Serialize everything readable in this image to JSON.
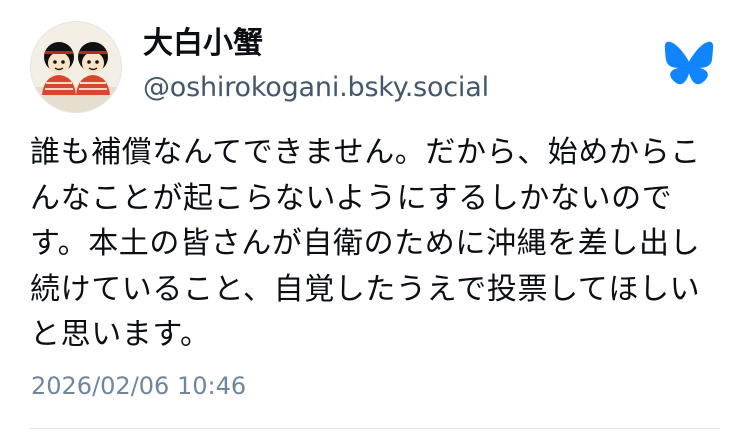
{
  "author": {
    "display_name": "大白小蟹",
    "handle": "@oshirokogani.bsky.social",
    "avatar_icon": "cartoon-two-figures-avatar"
  },
  "logo": {
    "icon": "bluesky-butterfly-icon",
    "color": "#1185fe"
  },
  "post": {
    "text": "誰も補償なんてできません。だから、始めからこんなことが起こらないようにするしかないのです。本土の皆さんが自衛のために沖縄を差し出し続けていること、自覚したうえで投票してほしいと思います。",
    "timestamp": "2026/02/06 10:46"
  },
  "colors": {
    "text": "#0b0f14",
    "handle": "#42576c",
    "timestamp": "#6f869f",
    "divider": "#dfe4ea"
  }
}
